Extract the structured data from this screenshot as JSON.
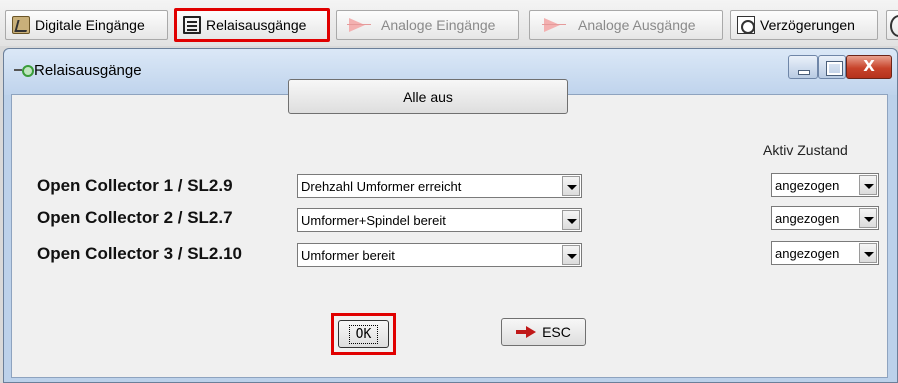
{
  "toolbar": {
    "items": [
      {
        "label": "Digitale Eingänge",
        "icon": "digital-inputs-icon"
      },
      {
        "label": "Relaisausgänge",
        "icon": "relay-outputs-icon",
        "highlighted": true
      },
      {
        "label": "Analoge Eingänge",
        "icon": "analog-inputs-icon",
        "disabled": true
      },
      {
        "label": "Analoge Ausgänge",
        "icon": "analog-outputs-icon",
        "disabled": true
      },
      {
        "label": "Verzögerungen",
        "icon": "delay-icon"
      }
    ]
  },
  "dialog": {
    "title": "Relaisausgänge",
    "close_glyph": "X",
    "all_off_label": "Alle aus",
    "active_state_header": "Aktiv Zustand",
    "rows": [
      {
        "label": "Open Collector 1 / SL2.9",
        "function": "Drehzahl Umformer erreicht",
        "state": "angezogen"
      },
      {
        "label": "Open Collector 2 / SL2.7",
        "function": "Umformer+Spindel bereit",
        "state": "angezogen"
      },
      {
        "label": "Open Collector 3 / SL2.10",
        "function": "Umformer bereit",
        "state": "angezogen"
      }
    ],
    "ok_label": "OK",
    "esc_label": "ESC"
  },
  "colors": {
    "highlight": "#e00000",
    "esc_arrow": "#c01818",
    "titlebar": "#bfd3ec"
  }
}
